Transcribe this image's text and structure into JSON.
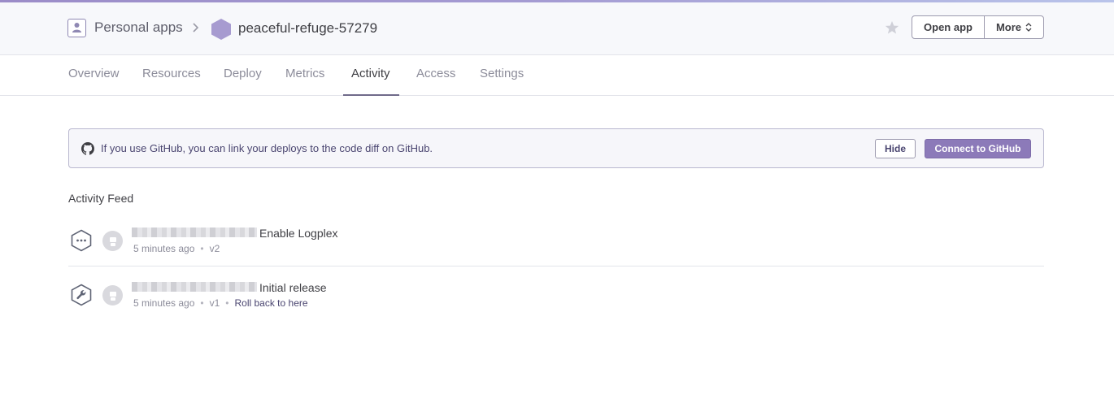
{
  "colors": {
    "accent": "#8c7ab9",
    "header_bg": "#f7f8fb",
    "hexagon": "#a79bd0"
  },
  "breadcrumb": {
    "personal_icon": "person-icon",
    "personal_label": "Personal apps",
    "separator_icon": "chevron-right-icon",
    "app_icon": "hexagon-icon",
    "app_name": "peaceful-refuge-57279"
  },
  "header_actions": {
    "favorite_icon": "star-icon",
    "open_app_label": "Open app",
    "more_label": "More",
    "more_icon": "up-down-chevron-icon"
  },
  "tabs": [
    {
      "label": "Overview",
      "active": false
    },
    {
      "label": "Resources",
      "active": false
    },
    {
      "label": "Deploy",
      "active": false
    },
    {
      "label": "Metrics",
      "active": false
    },
    {
      "label": "Activity",
      "active": true
    },
    {
      "label": "Access",
      "active": false
    },
    {
      "label": "Settings",
      "active": false
    }
  ],
  "github_banner": {
    "icon": "github-icon",
    "text": "If you use GitHub, you can link your deploys to the code diff on GitHub.",
    "hide_label": "Hide",
    "connect_label": "Connect to GitHub"
  },
  "feed": {
    "title": "Activity Feed",
    "items": [
      {
        "event_icon": "ellipsis-hexagon-icon",
        "avatar_icon": "user-avatar-icon",
        "text": "Enable Logplex",
        "time": "5 minutes ago",
        "version": "v2"
      },
      {
        "event_icon": "wrench-hexagon-icon",
        "avatar_icon": "user-avatar-icon",
        "text": "Initial release",
        "time": "5 minutes ago",
        "version": "v1",
        "action_label": "Roll back to here"
      }
    ]
  }
}
